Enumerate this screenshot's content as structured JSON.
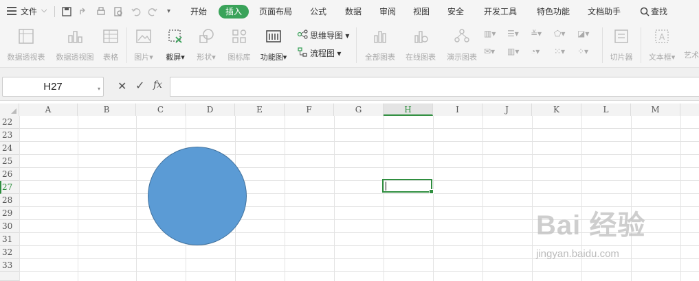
{
  "menubar": {
    "file_label": "文件",
    "tabs": [
      "开始",
      "插入",
      "页面布局",
      "公式",
      "数据",
      "审阅",
      "视图",
      "安全",
      "开发工具",
      "特色功能",
      "文档助手"
    ],
    "active_tab": "插入",
    "search_label": "查找",
    "accent_color": "#3aa35a"
  },
  "ribbon": {
    "pivot_table": "数据透视表",
    "pivot_chart": "数据透视图",
    "table": "表格",
    "picture": "图片",
    "screenshot": "截屏",
    "shapes": "形状",
    "icon_library": "图标库",
    "function_chart": "功能图",
    "mind_map": "思维导图",
    "flowchart": "流程图",
    "all_charts": "全部图表",
    "online_charts": "在线图表",
    "demo_charts": "演示图表",
    "slicer": "切片器",
    "textbox": "文本框",
    "art_text": "艺术"
  },
  "formula_bar": {
    "cell_name": "H27",
    "cancel_symbol": "✕",
    "confirm_symbol": "✓",
    "fx_label": "fx",
    "value": ""
  },
  "sheet": {
    "columns": [
      "A",
      "B",
      "C",
      "D",
      "E",
      "F",
      "G",
      "H",
      "I",
      "J",
      "K",
      "L",
      "M"
    ],
    "rows": [
      "22",
      "23",
      "24",
      "25",
      "26",
      "27",
      "28",
      "29",
      "30",
      "31",
      "32",
      "33"
    ],
    "active_column": "H",
    "active_row": "27",
    "shape_fill": "#5b9bd5",
    "selection_color": "#2f8e3f"
  },
  "watermark": {
    "brand": "Bai 经验",
    "site": "jingyan.baidu.com"
  }
}
